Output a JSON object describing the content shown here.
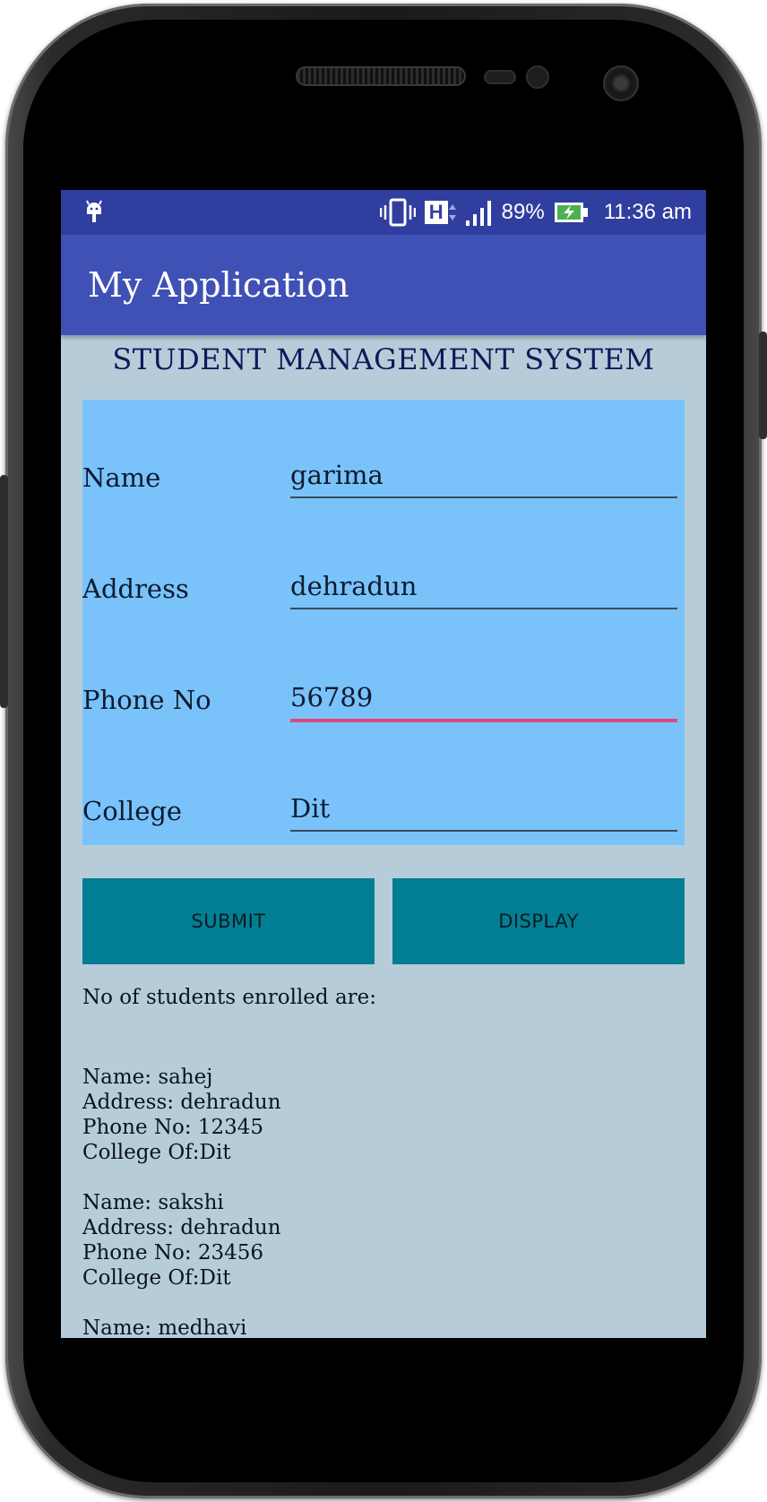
{
  "status_bar": {
    "battery_percent": "89%",
    "time": "11:36 am",
    "network_type": "H",
    "icons": [
      "android-notification-icon",
      "vibrate-icon",
      "network-h-icon",
      "signal-icon",
      "battery-charging-icon"
    ]
  },
  "app_bar": {
    "title": "My Application"
  },
  "page": {
    "heading": "STUDENT MANAGEMENT SYSTEM"
  },
  "form": {
    "fields": [
      {
        "label": "Name",
        "value": "garima"
      },
      {
        "label": "Address",
        "value": "dehradun"
      },
      {
        "label": "Phone No",
        "value": "56789"
      },
      {
        "label": "College",
        "value": "Dit"
      }
    ]
  },
  "buttons": {
    "submit": "SUBMIT",
    "display": "DISPLAY"
  },
  "enrolled": {
    "label": "No of students enrolled are:",
    "records": [
      {
        "name": "Name: sahej",
        "address": "Address: dehradun",
        "phone": "Phone No: 12345",
        "college": "College Of:Dit"
      },
      {
        "name": "Name: sakshi",
        "address": "Address: dehradun",
        "phone": "Phone No: 23456",
        "college": "College Of:Dit"
      },
      {
        "name": "Name: medhavi",
        "address": "",
        "phone": "",
        "college": ""
      }
    ]
  },
  "colors": {
    "status_bar": "#303f9f",
    "app_bar": "#3f51b5",
    "screen_background": "#b6cdd9",
    "form_panel": "#79c3fa",
    "button": "#027e94",
    "focus_underline": "#e0487b"
  }
}
